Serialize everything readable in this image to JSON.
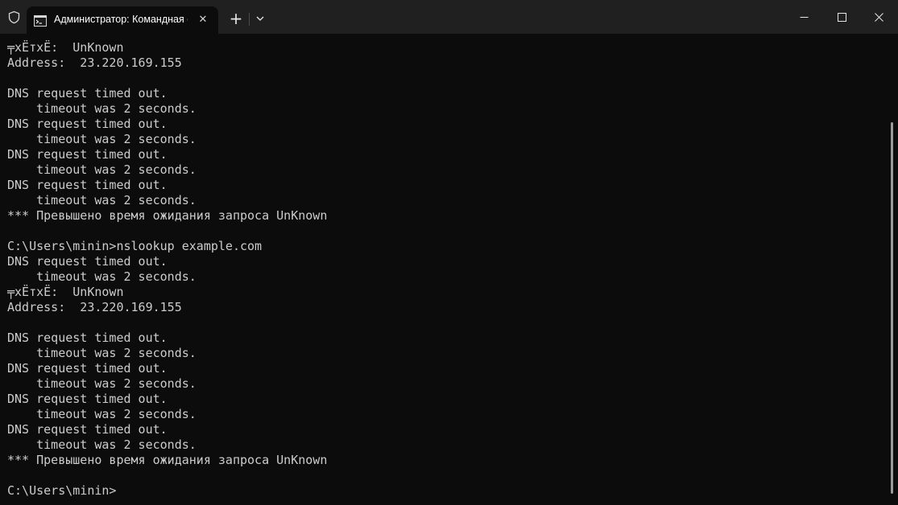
{
  "window": {
    "tab_title": "Администратор: Командная с",
    "tab_close_glyph": "✕",
    "new_tab_glyph": "+"
  },
  "terminal": {
    "lines": [
      "╤xЁтxЁ:  UnKnown",
      "Address:  23.220.169.155",
      "",
      "DNS request timed out.",
      "    timeout was 2 seconds.",
      "DNS request timed out.",
      "    timeout was 2 seconds.",
      "DNS request timed out.",
      "    timeout was 2 seconds.",
      "DNS request timed out.",
      "    timeout was 2 seconds.",
      "*** Превышено время ожидания запроса UnKnown",
      "",
      "C:\\Users\\minin>nslookup example.com",
      "DNS request timed out.",
      "    timeout was 2 seconds.",
      "╤xЁтxЁ:  UnKnown",
      "Address:  23.220.169.155",
      "",
      "DNS request timed out.",
      "    timeout was 2 seconds.",
      "DNS request timed out.",
      "    timeout was 2 seconds.",
      "DNS request timed out.",
      "    timeout was 2 seconds.",
      "DNS request timed out.",
      "    timeout was 2 seconds.",
      "*** Превышено время ожидания запроса UnKnown",
      "",
      "C:\\Users\\minin>"
    ]
  },
  "icons": {
    "shield": "shield-icon",
    "terminal": "cmd-terminal-icon",
    "dropdown": "chevron-down-icon",
    "minimize": "minimize-icon",
    "maximize": "maximize-icon",
    "close": "close-icon"
  }
}
